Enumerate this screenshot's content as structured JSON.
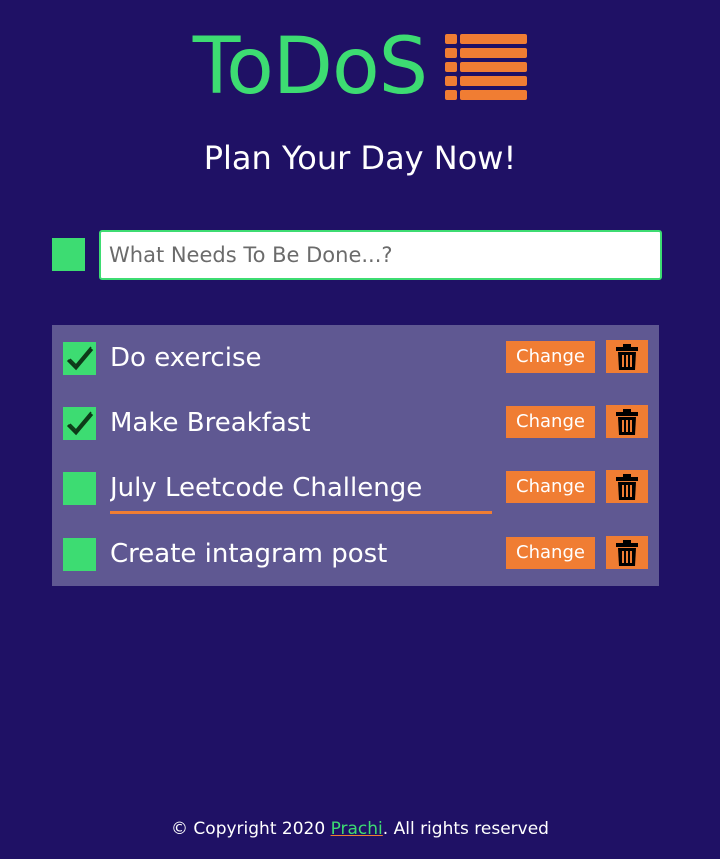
{
  "app": {
    "title": "ToDoS",
    "tagline": "Plan Your Day Now!",
    "logo_icon": "list-icon"
  },
  "new_todo": {
    "placeholder": "What Needs To Be Done...?",
    "value": ""
  },
  "todos": [
    {
      "label": "Do exercise",
      "done": true
    },
    {
      "label": "Make Breakfast",
      "done": true
    },
    {
      "label": "July Leetcode Challenge",
      "done": false,
      "editing": true
    },
    {
      "label": "Create intagram post",
      "done": false
    }
  ],
  "actions": {
    "change_label": "Change",
    "delete_icon": "trash-icon",
    "check_icon": "checkmark-icon"
  },
  "footer": {
    "prefix": "© Copyright 2020 ",
    "author": "Prachi",
    "suffix": ". All rights reserved"
  },
  "colors": {
    "background": "#1f1165",
    "accent_green": "#3ddc72",
    "accent_orange": "#f07d33",
    "list_background": "#5f5892"
  }
}
